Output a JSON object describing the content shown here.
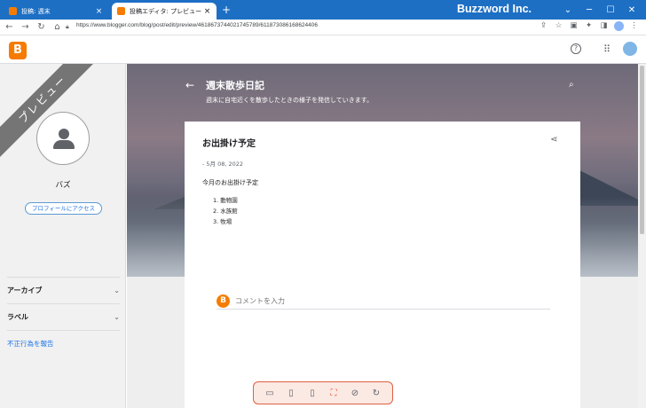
{
  "browser": {
    "tabs": [
      {
        "title": "投稿: 週末",
        "active": false
      },
      {
        "title": "投稿エディタ: プレビュー",
        "active": true
      }
    ],
    "new_tab_symbol": "+",
    "tab_close_symbol": "×",
    "url": "https://www.blogger.com/blog/post/edit/preview/4618673744021745789/6118730861686244​06",
    "window_title": "Buzzword Inc.",
    "window_buttons": [
      "⌄",
      "─",
      "☐",
      "✕"
    ]
  },
  "appbar": {
    "logo_letter": "B",
    "help_symbol": "?",
    "apps_symbol": "⋮⋮⋮"
  },
  "sidebar": {
    "ribbon": "プレビュー",
    "profile_name": "バズ",
    "profile_button": "プロフィールにアクセス",
    "sections": [
      {
        "label": "アーカイブ",
        "chevron": "⌄"
      },
      {
        "label": "ラベル",
        "chevron": "⌄"
      }
    ],
    "report_link": "不正行為を報告"
  },
  "blog": {
    "back_symbol": "←",
    "title": "週末散歩日記",
    "description": "週末に自宅近くを散歩したときの様子を発信していきます。",
    "search_symbol": "⌕"
  },
  "post": {
    "title": "お出掛け予定",
    "share_symbol": "⋖",
    "date": "- 5月 08, 2022",
    "intro": "今月のお出掛け予定",
    "list": [
      "1. 動物園",
      "2. 水族館",
      "3. 牧場"
    ],
    "comment_logo": "B",
    "comment_placeholder": "コメントを入力"
  },
  "device_toolbar": {
    "buttons": [
      {
        "icon": "desktop-icon",
        "symbol": "▭"
      },
      {
        "icon": "tablet-icon",
        "symbol": "▯"
      },
      {
        "icon": "mobile-icon",
        "symbol": "▯"
      },
      {
        "icon": "fullscreen-icon",
        "symbol": "⛶"
      },
      {
        "icon": "rotate-icon",
        "symbol": "⊘"
      },
      {
        "icon": "refresh-icon",
        "symbol": "↻"
      }
    ]
  },
  "colors": {
    "titlebar": "#1d6fc4",
    "blogger_orange": "#f57c00",
    "accent": "#e8552d",
    "link": "#1a73e8"
  }
}
